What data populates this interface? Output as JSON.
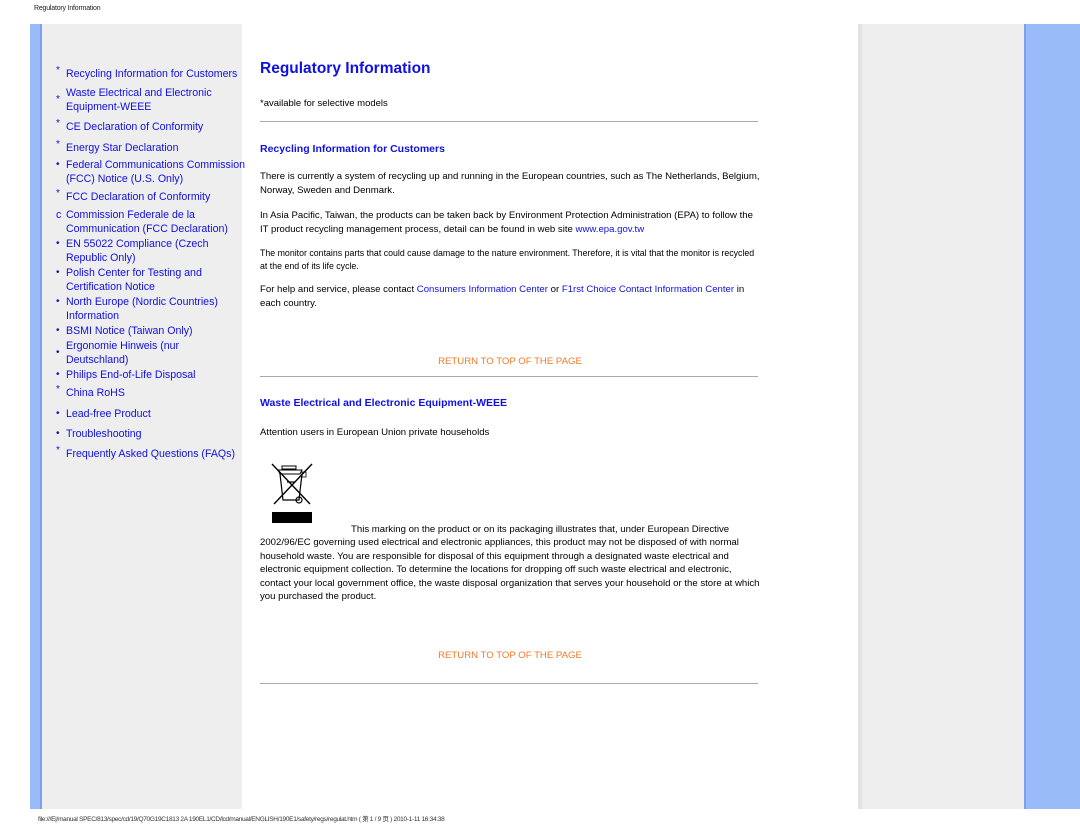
{
  "page_header": "Regulatory Information",
  "sidebar": {
    "items": [
      {
        "bullet": "*",
        "label": "Recycling Information for Customers"
      },
      {
        "bullet": "*",
        "label": "Waste Electrical and Electronic Equipment-WEEE"
      },
      {
        "bullet": "*",
        "label": "CE Declaration of Conformity"
      },
      {
        "bullet": "*",
        "label": "Energy Star Declaration"
      },
      {
        "bullet": "•",
        "label": "Federal Communications Commission (FCC) Notice (U.S. Only)"
      },
      {
        "bullet": "*",
        "label": "FCC Declaration of Conformity"
      },
      {
        "bullet": "c",
        "label": "Commission Federale de la Communication (FCC Declaration)"
      },
      {
        "bullet": "•",
        "label": "EN 55022 Compliance (Czech Republic Only)"
      },
      {
        "bullet": "•",
        "label": "Polish Center for Testing and Certification Notice"
      },
      {
        "bullet": "•",
        "label": "North Europe (Nordic Countries) Information"
      },
      {
        "bullet": "•",
        "label": "BSMI Notice (Taiwan Only)"
      },
      {
        "bullet": "•",
        "label": "Ergonomie Hinweis (nur Deutschland)"
      },
      {
        "bullet": "•",
        "label": "Philips End-of-Life Disposal"
      },
      {
        "bullet": "*",
        "label": "China RoHS"
      },
      {
        "bullet": "•",
        "label": "Lead-free Product"
      },
      {
        "bullet": "•",
        "label": "Troubleshooting"
      },
      {
        "bullet": "*",
        "label": "Frequently Asked Questions (FAQs)"
      }
    ]
  },
  "main": {
    "title": "Regulatory Information",
    "note": "*available for selective models",
    "recycling": {
      "heading": "Recycling Information for Customers",
      "p1": "There is currently a system of recycling up and running in the European countries, such as The Netherlands, Belgium, Norway, Sweden and Denmark.",
      "p2_text": "In Asia Pacific, Taiwan, the products can be taken back by Environment Protection Administration (EPA) to follow the IT product recycling management process, detail can be found in web site ",
      "p2_link": "www.epa.gov.tw",
      "p3": "The monitor contains parts that could cause damage to the nature environment. Therefore, it is vital that the monitor is recycled at the end of its life cycle.",
      "p4_pre": "For help and service, please contact ",
      "p4_link1": "Consumers Information Center",
      "p4_mid": " or ",
      "p4_link2": "F1rst Choice Contact Information Center",
      "p4_post": " in each country."
    },
    "return_top": "RETURN TO TOP OF THE PAGE",
    "weee": {
      "heading": "Waste Electrical and Electronic Equipment-WEEE",
      "attention": "Attention users in European Union private households",
      "icon": "crossed-out-wheelie-bin-icon",
      "body": "This marking on the product or on its packaging illustrates that, under European Directive 2002/96/EC governing used electrical and electronic appliances, this product may not be disposed of with normal household waste. You are responsible for disposal of this equipment through a designated waste electrical and electronic equipment collection. To determine the locations for dropping off such waste electrical and electronic, contact your local government office, the waste disposal organization that serves your household or the store at which you purchased the product."
    }
  },
  "footer": "file:///E|/manual SPEC/813/spec/cd/19/Q70G19C1813 2A 190EL1/CD/lcd/manual/ENGLISH/190E1/safety/regs/regulat.htm ( 第 1 / 9 页 ) 2010-1-11 16:34:38",
  "colors": {
    "link": "#1010e0",
    "return_link": "#f07a2a",
    "panel_gray": "#eeeeee",
    "panel_blue": "#99bbf8"
  }
}
